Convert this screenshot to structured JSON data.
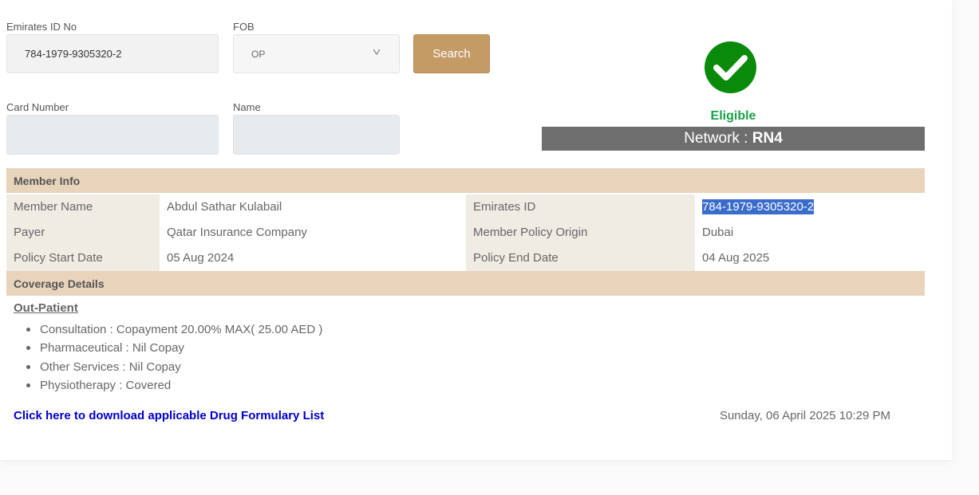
{
  "form": {
    "emirates_id_label": "Emirates ID No",
    "emirates_id_value": "784-1979-9305320-2",
    "fob_label": "FOB",
    "fob_value": "OP",
    "search_label": "Search",
    "card_number_label": "Card Number",
    "card_number_value": "",
    "name_label": "Name",
    "name_value": ""
  },
  "status": {
    "eligibility": "Eligible",
    "network_prefix": "Network : ",
    "network_value": "RN4",
    "check_icon": "check-circle-icon",
    "check_color": "#0a8a0a",
    "eligible_color": "#1aa04a"
  },
  "member_info": {
    "title": "Member Info",
    "rows": [
      {
        "k1": "Member Name",
        "v1": "Abdul Sathar Kulabail",
        "k2": "Emirates ID",
        "v2": "784-1979-9305320-2"
      },
      {
        "k1": "Payer",
        "v1": "Qatar Insurance Company",
        "k2": "Member Policy Origin",
        "v2": "Dubai"
      },
      {
        "k1": "Policy Start Date",
        "v1": "05 Aug 2024",
        "k2": "Policy End Date",
        "v2": "04 Aug 2025"
      }
    ]
  },
  "coverage": {
    "title": "Coverage Details",
    "section_title": "Out-Patient",
    "items": [
      "Consultation : Copayment 20.00% MAX( 25.00 AED )",
      "Pharmaceutical : Nil Copay",
      "Other Services : Nil Copay",
      "Physiotherapy : Covered"
    ]
  },
  "footer": {
    "drug_link": "Click here to download applicable Drug Formulary List",
    "timestamp": "Sunday, 06 April 2025 10:29 PM"
  },
  "colors": {
    "accent": "#c49a65",
    "section_bg": "#e8d4bb",
    "network_bg": "#6e6e6e",
    "link": "#0000cc",
    "selection": "#3a6ccc"
  }
}
